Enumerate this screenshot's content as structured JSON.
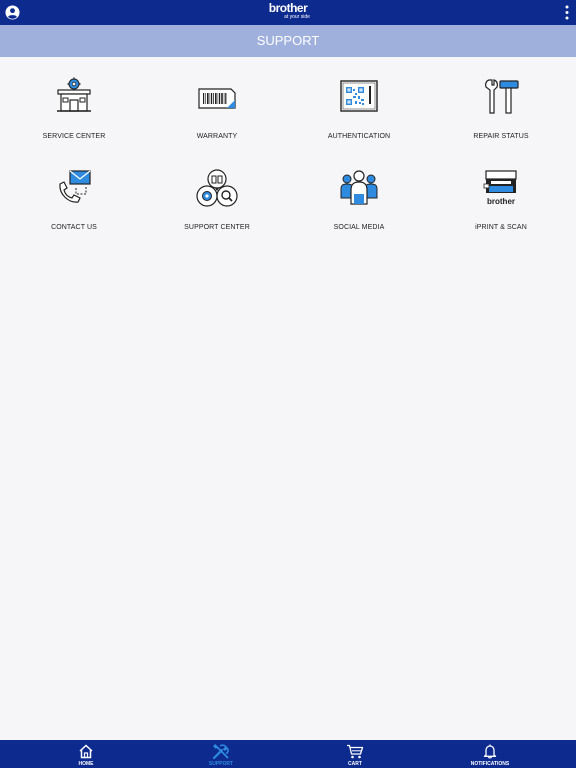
{
  "header": {
    "logo_text": "brother",
    "logo_tagline": "at your side"
  },
  "page": {
    "title": "SUPPORT"
  },
  "tiles": [
    {
      "label": "SERVICE CENTER",
      "icon": "service-center-icon"
    },
    {
      "label": "WARRANTY",
      "icon": "warranty-icon"
    },
    {
      "label": "AUTHENTICATION",
      "icon": "authentication-icon"
    },
    {
      "label": "REPAIR STATUS",
      "icon": "repair-status-icon"
    },
    {
      "label": "CONTACT US",
      "icon": "contact-us-icon"
    },
    {
      "label": "SUPPORT CENTER",
      "icon": "support-center-icon"
    },
    {
      "label": "SOCIAL MEDIA",
      "icon": "social-media-icon"
    },
    {
      "label": "iPRINT & SCAN",
      "icon": "iprint-scan-icon",
      "brand_text": "brother"
    }
  ],
  "bottom_nav": [
    {
      "label": "HOME",
      "icon": "home-icon",
      "active": false
    },
    {
      "label": "SUPPORT",
      "icon": "tools-icon",
      "active": true
    },
    {
      "label": "CART",
      "icon": "cart-icon",
      "active": false
    },
    {
      "label": "NOTIFICATIONS",
      "icon": "bell-icon",
      "active": false
    }
  ],
  "colors": {
    "brand_blue": "#0d2a8f",
    "header_band": "#9fb0dc",
    "accent": "#2f8be0",
    "background": "#f6f6f8"
  }
}
